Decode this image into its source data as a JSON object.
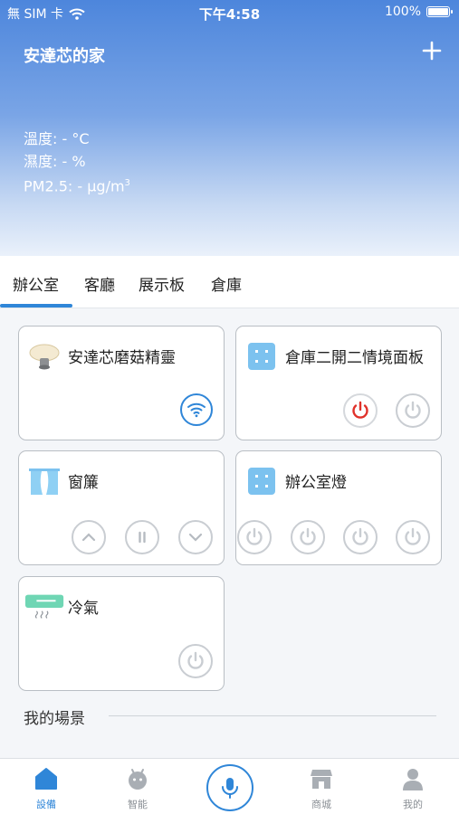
{
  "status_bar": {
    "carrier": "無 SIM 卡",
    "time": "下午4:58",
    "battery": "100%",
    "battery_level": 1.0
  },
  "header": {
    "title": "安達芯的家"
  },
  "environment": {
    "temperature": "溫度: - °C",
    "humidity": "濕度: - %",
    "pm25_prefix": "PM2.5: - µg/m",
    "pm25_sup": "3"
  },
  "tabs": [
    {
      "label": "辦公室",
      "active": true
    },
    {
      "label": "客廳",
      "active": false
    },
    {
      "label": "展示板",
      "active": false
    },
    {
      "label": "倉庫",
      "active": false
    }
  ],
  "devices": [
    {
      "name": "安達芯磨菇精靈",
      "icon": "mushroom-lamp-icon"
    },
    {
      "name": "倉庫二開二情境面板",
      "icon": "scene-panel-icon"
    },
    {
      "name": "窗簾",
      "icon": "curtain-icon"
    },
    {
      "name": "辦公室燈",
      "icon": "switch-panel-icon"
    },
    {
      "name": "冷氣",
      "icon": "air-conditioner-icon"
    }
  ],
  "section": {
    "scenes_title": "我的場景"
  },
  "bottom_nav": [
    {
      "label": "設備",
      "icon": "home-icon",
      "active": true
    },
    {
      "label": "智能",
      "icon": "robot-icon",
      "active": false
    },
    {
      "label": "",
      "icon": "microphone-icon",
      "active": false
    },
    {
      "label": "商城",
      "icon": "store-icon",
      "active": false
    },
    {
      "label": "我的",
      "icon": "user-icon",
      "active": false
    }
  ],
  "colors": {
    "accent": "#2f86d8",
    "power_on": "#e0312a",
    "hero_top": "#4d86dc"
  }
}
